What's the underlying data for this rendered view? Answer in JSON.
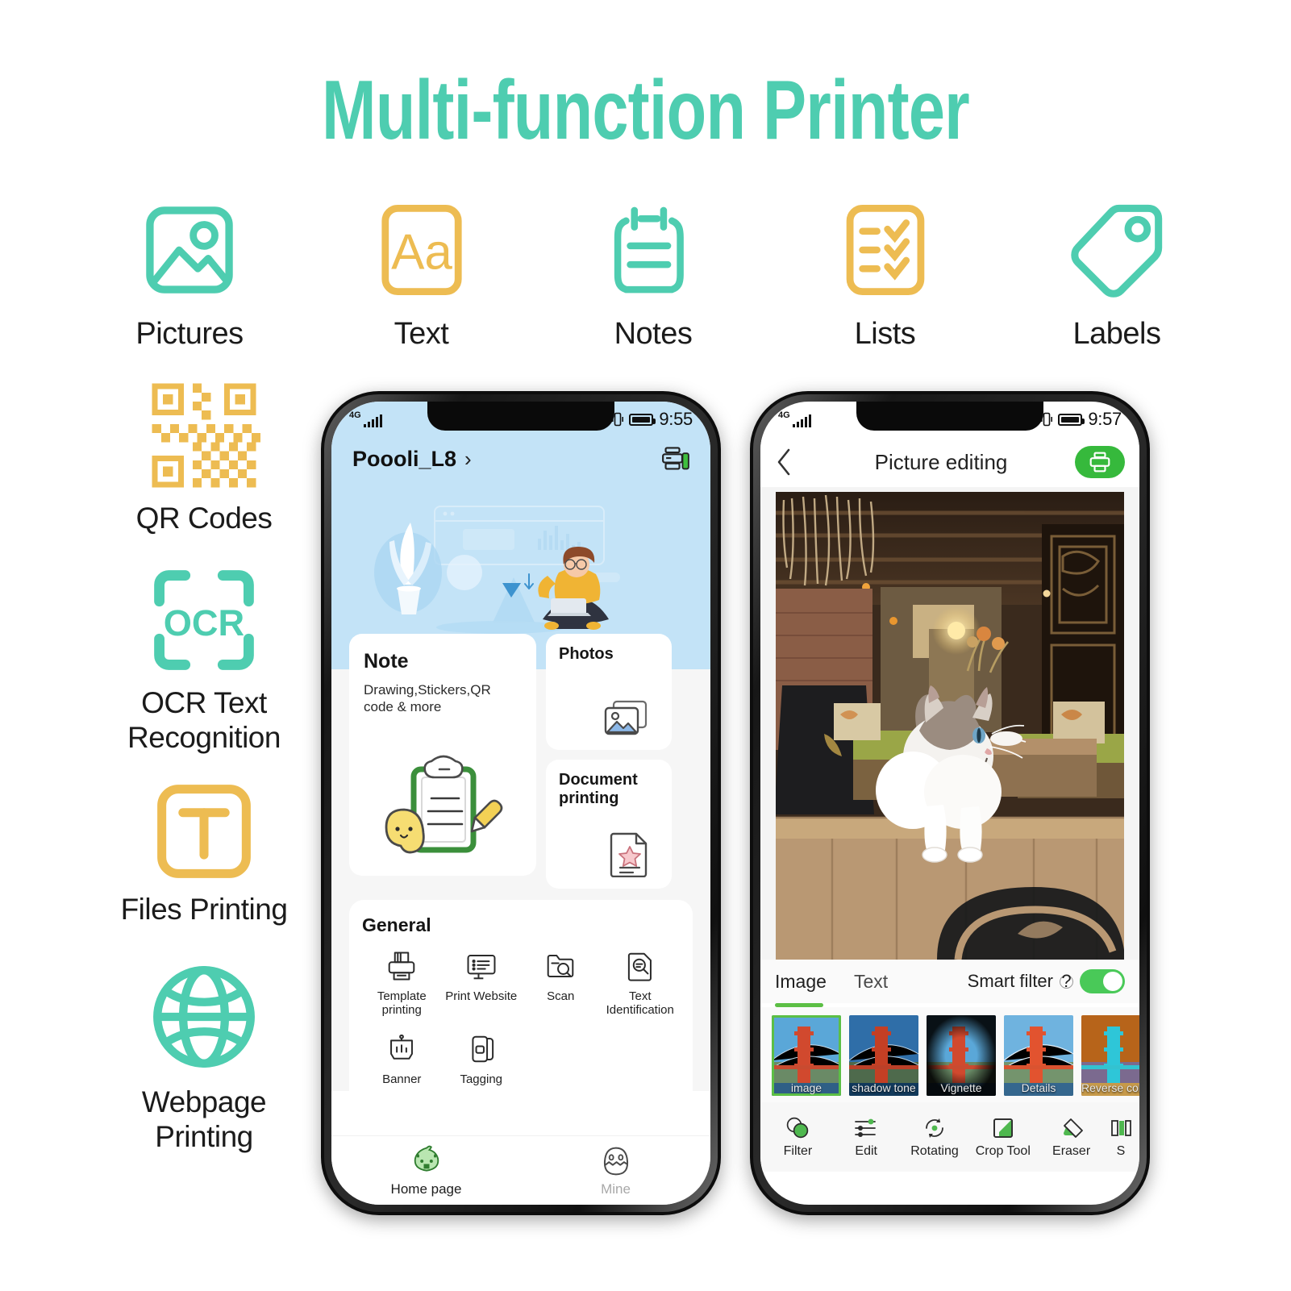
{
  "header": {
    "title": "Multi-function Printer",
    "accent": "#4ecdb0",
    "gold": "#edbc52"
  },
  "top_features": [
    {
      "label": "Pictures",
      "icon": "picture-icon",
      "color": "#4ecdb0"
    },
    {
      "label": "Text",
      "icon": "text-aa-icon",
      "color": "#edbc52"
    },
    {
      "label": "Notes",
      "icon": "notes-icon",
      "color": "#4ecdb0"
    },
    {
      "label": "Lists",
      "icon": "checklist-icon",
      "color": "#edbc52"
    },
    {
      "label": "Labels",
      "icon": "tag-icon",
      "color": "#4ecdb0"
    }
  ],
  "left_features": [
    {
      "label": "QR Codes",
      "icon": "qr-code-icon",
      "color": "#edbc52"
    },
    {
      "label": "OCR Text\nRecognition",
      "line1": "OCR Text",
      "line2": "Recognition",
      "icon": "ocr-icon",
      "color": "#4ecdb0"
    },
    {
      "label": "Files Printing",
      "line1": "Files Printing",
      "line2": "",
      "icon": "file-t-icon",
      "color": "#edbc52"
    },
    {
      "label": "Webpage Printing",
      "line1": "Webpage",
      "line2": "Printing",
      "icon": "globe-icon",
      "color": "#4ecdb0"
    }
  ],
  "phone1": {
    "status": {
      "network": "4G",
      "time": "9:55"
    },
    "device_name": "Poooli_L8",
    "chevron": "›",
    "printer_status_icon": "printer-battery-icon",
    "cards": {
      "note": {
        "title": "Note",
        "subtitle": "Drawing,Stickers,QR code & more",
        "icon": "clipboard-pencil-icon"
      },
      "photos": {
        "title": "Photos",
        "icon": "photo-icon"
      },
      "document": {
        "title": "Document printing",
        "icon": "document-star-icon"
      }
    },
    "general": {
      "heading": "General",
      "items": [
        {
          "label": "Template printing",
          "icon": "template-printing-icon"
        },
        {
          "label": "Print Website",
          "icon": "print-website-icon"
        },
        {
          "label": "Scan",
          "icon": "scan-folder-icon"
        },
        {
          "label": "Text Identification",
          "icon": "text-identification-icon"
        },
        {
          "label": "Banner",
          "icon": "banner-icon"
        },
        {
          "label": "Tagging",
          "icon": "tagging-icon"
        }
      ]
    },
    "tabs": [
      {
        "label": "Home page",
        "icon": "home-chick-icon",
        "active": true
      },
      {
        "label": "Mine",
        "icon": "mine-egg-icon",
        "active": false
      }
    ]
  },
  "phone2": {
    "status": {
      "network": "4G",
      "time": "9:57"
    },
    "nav": {
      "back_icon": "back-chevron-icon",
      "title": "Picture editing",
      "print_icon": "printer-icon",
      "print_color": "#36b93c"
    },
    "photo_alt": "cat standing on wooden counter in a teahouse",
    "tabs": [
      {
        "label": "Image",
        "active": true
      },
      {
        "label": "Text",
        "active": false
      }
    ],
    "smart_filter": {
      "label": "Smart filter",
      "help_icon": "question-icon",
      "enabled": true,
      "on_color": "#49c958"
    },
    "filters": [
      {
        "label": "image",
        "selected": true
      },
      {
        "label": "shadow tone",
        "selected": false
      },
      {
        "label": "Vignette",
        "selected": false
      },
      {
        "label": "Details",
        "selected": false
      },
      {
        "label": "Reverse color",
        "selected": false
      }
    ],
    "toolbar": [
      {
        "label": "Filter",
        "icon": "filter-circles-icon"
      },
      {
        "label": "Edit",
        "icon": "sliders-icon"
      },
      {
        "label": "Rotating",
        "icon": "rotate-icon"
      },
      {
        "label": "Crop Tool",
        "icon": "crop-icon"
      },
      {
        "label": "Eraser",
        "icon": "eraser-icon"
      },
      {
        "label": "S",
        "icon": "split-icon"
      }
    ]
  }
}
